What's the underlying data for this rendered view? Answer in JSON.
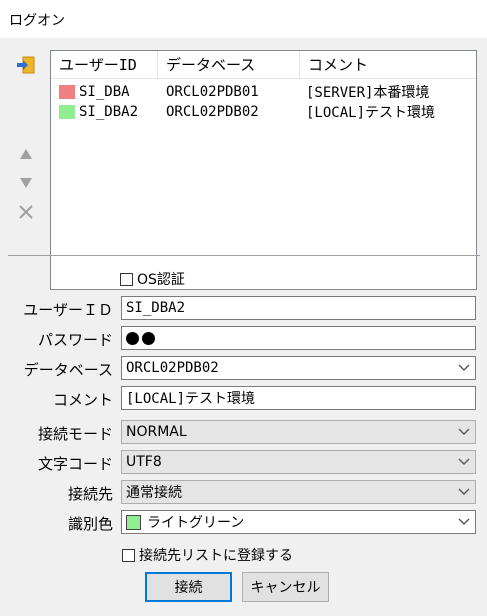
{
  "window": {
    "title": "ログオン"
  },
  "connection_list": {
    "columns": [
      "ユーザーID",
      "データベース",
      "コメント"
    ],
    "rows": [
      {
        "user_id": "SI_DBA",
        "database": "ORCL02PDB01",
        "comment": "[SERVER]本番環境",
        "color": "#f08080"
      },
      {
        "user_id": "SI_DBA2",
        "database": "ORCL02PDB02",
        "comment": "[LOCAL]テスト環境",
        "color": "#90ee90"
      }
    ]
  },
  "side_tools": {
    "import_icon": "import-icon",
    "move_up_icon": "arrow-up-icon",
    "move_down_icon": "arrow-down-icon",
    "delete_icon": "close-icon"
  },
  "form": {
    "os_auth_label": "OS認証",
    "user_id_label": "ユーザーＩＤ",
    "user_id_value": "SI_DBA2",
    "password_label": "パスワード",
    "password_length": 2,
    "database_label": "データベース",
    "database_value": "ORCL02PDB02",
    "comment_label": "コメント",
    "comment_value": "[LOCAL]テスト環境",
    "connect_mode_label": "接続モード",
    "connect_mode_value": "NORMAL",
    "charset_label": "文字コード",
    "charset_value": "UTF8",
    "destination_label": "接続先",
    "destination_value": "通常接続",
    "color_label": "識別色",
    "color_value": "ライトグリーン",
    "color_swatch": "#90ee90",
    "register_label": "接続先リストに登録する"
  },
  "buttons": {
    "connect": "接続",
    "cancel": "キャンセル"
  },
  "colors": {
    "accent": "#0078d7",
    "import_icon": "#f0b429"
  }
}
